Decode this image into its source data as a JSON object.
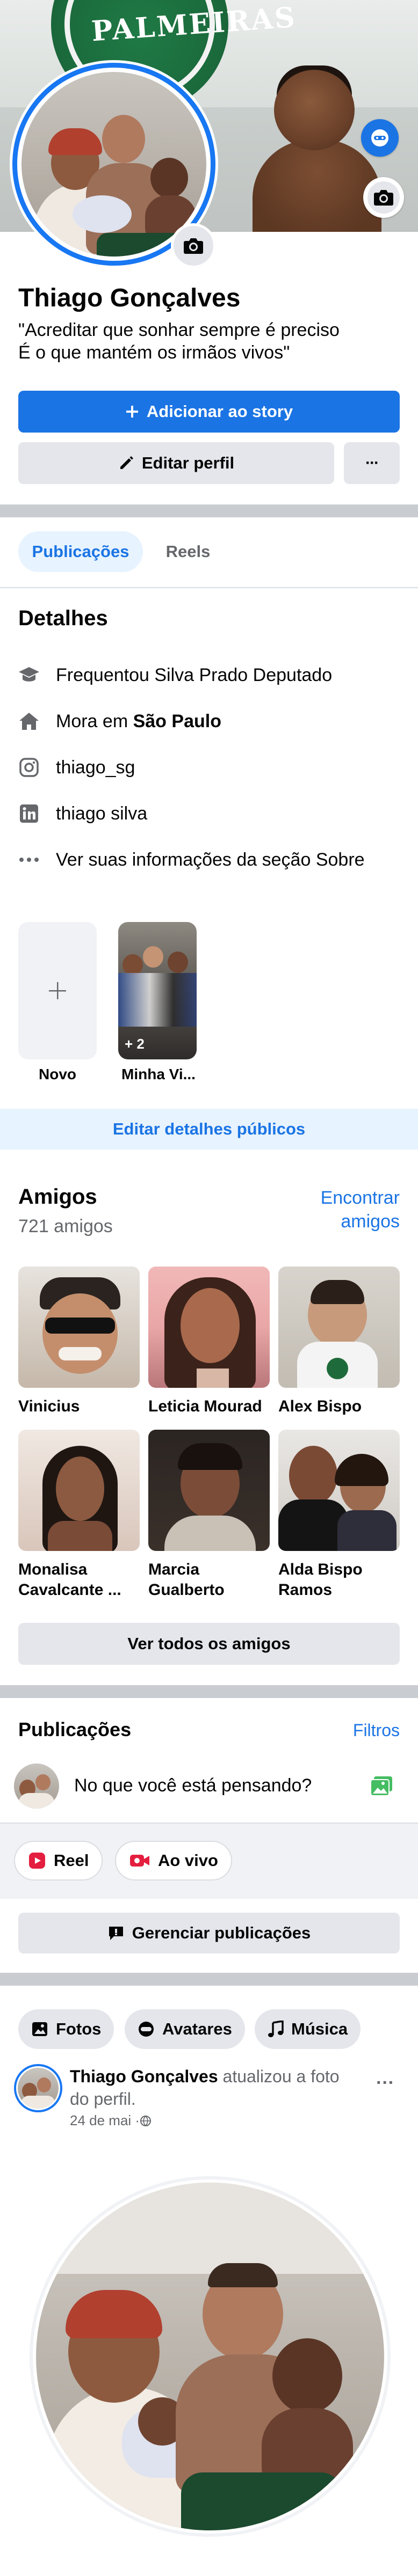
{
  "profile": {
    "name": "Thiago Gonçalves",
    "bio_line1": "\"Acreditar que sonhar sempre é preciso",
    "bio_line2": "É o que mantém os irmãos vivos\""
  },
  "actions": {
    "add_story": "Adicionar ao story",
    "edit_profile": "Editar perfil",
    "more": "···"
  },
  "tabs": [
    {
      "label": "Publicações"
    },
    {
      "label": "Reels"
    }
  ],
  "details": {
    "title": "Detalhes",
    "items": [
      {
        "icon": "graduation-cap-icon",
        "text": "Frequentou Silva Prado Deputado"
      },
      {
        "icon": "home-icon",
        "prefix": "Mora em ",
        "bold": "São Paulo"
      },
      {
        "icon": "instagram-icon",
        "text": "thiago_sg"
      },
      {
        "icon": "linkedin-icon",
        "text": "thiago silva"
      },
      {
        "icon": "more-dots-icon",
        "text": "Ver suas informações da seção Sobre"
      }
    ]
  },
  "highlights": {
    "new_label": "Novo",
    "album_label": "Minha Vi...",
    "album_count": "+ 2",
    "edit_public": "Editar detalhes públicos"
  },
  "friends": {
    "title": "Amigos",
    "count": "721 amigos",
    "find_line1": "Encontrar",
    "find_line2": "amigos",
    "list": [
      {
        "line1": "Vinicius",
        "line2": ""
      },
      {
        "line1": "Leticia Mourad",
        "line2": ""
      },
      {
        "line1": "Alex Bispo",
        "line2": ""
      },
      {
        "line1": "Monalisa",
        "line2": "Cavalcante ..."
      },
      {
        "line1": "Marcia",
        "line2": "Gualberto"
      },
      {
        "line1": "Alda Bispo",
        "line2": "Ramos"
      }
    ],
    "see_all": "Ver todos os amigos"
  },
  "posts": {
    "title": "Publicações",
    "filters": "Filtros",
    "composer_placeholder": "No que você está pensando?",
    "reel": "Reel",
    "live": "Ao vivo",
    "manage": "Gerenciar publicações"
  },
  "chips": {
    "photos": "Fotos",
    "avatars": "Avatares",
    "music": "Música"
  },
  "feed_post": {
    "author": "Thiago Gonçalves",
    "action_a": " atualizou a foto",
    "action_b": "do perfil.",
    "date": "24 de mai · ",
    "more": "···"
  },
  "colors": {
    "accent": "#1b74e4",
    "divider": "#c9ccd1",
    "secondary_bg": "#e4e6eb",
    "tab_active_bg": "#e7f3ff"
  }
}
